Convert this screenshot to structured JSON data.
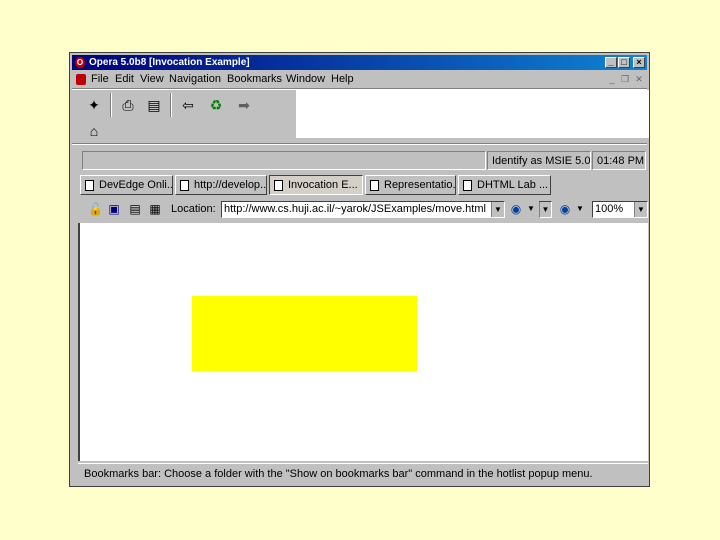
{
  "window": {
    "title": "Opera 5.0b8 [Invocation Example]"
  },
  "menubar": {
    "items": [
      "File",
      "Edit",
      "View",
      "Navigation",
      "Bookmarks",
      "Window",
      "Help"
    ]
  },
  "toolbar": {
    "icons": [
      "new-page-icon",
      "print-icon",
      "hotlist-icon",
      "back-icon",
      "reload-icon",
      "forward-icon",
      "home-icon"
    ]
  },
  "status": {
    "identify_as": "Identify as MSIE 5.0",
    "time": "01:48 PM"
  },
  "tabs": [
    {
      "label": "DevEdge Onli..."
    },
    {
      "label": "http://develop..."
    },
    {
      "label": "Invocation E..."
    },
    {
      "label": "Representatio..."
    },
    {
      "label": "DHTML Lab ..."
    }
  ],
  "address": {
    "location_label": "Location:",
    "url": "http://www.cs.huji.ac.il/~yarok/JSExamples/move.html",
    "zoom": "100%"
  },
  "content": {
    "box_color": "#ffff00"
  },
  "bookmarks_bar": {
    "text": "Bookmarks bar: Choose a folder with the \"Show on bookmarks bar\" command in the hotlist popup menu."
  }
}
